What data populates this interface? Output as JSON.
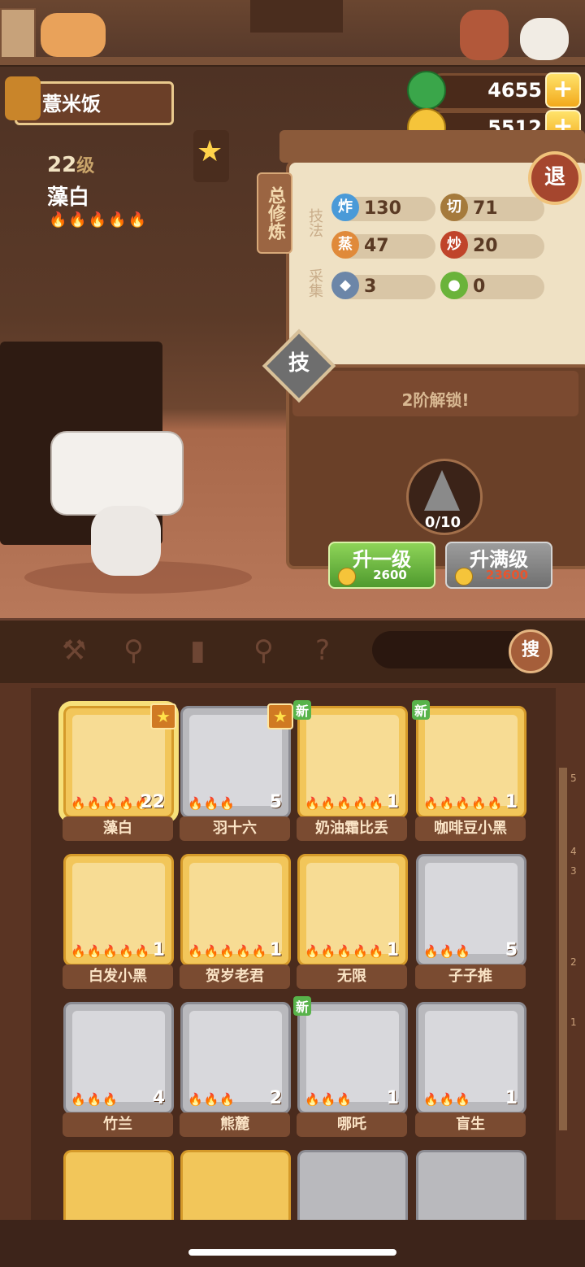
{
  "player": {
    "name": "薏米饭"
  },
  "character": {
    "level": "22",
    "level_suffix": "级",
    "name": "藻白",
    "flames": "🔥🔥🔥🔥🔥"
  },
  "currency": {
    "jade": "4655",
    "coins": "5512"
  },
  "skills": {
    "side_label": "总修炼",
    "category_technique": "技法",
    "category_gather": "采集",
    "stats": [
      {
        "icon": "炸",
        "value": "130",
        "color": "#4a9ad8"
      },
      {
        "icon": "切",
        "value": "71",
        "color": "#a57a3c"
      },
      {
        "icon": "蒸",
        "value": "47",
        "color": "#e08a3a"
      },
      {
        "icon": "炒",
        "value": "20",
        "color": "#c0442a"
      },
      {
        "icon": "fish-icon",
        "value": "3",
        "color": "#6c86a8"
      },
      {
        "icon": "cabbage-icon",
        "value": "0",
        "color": "#6ab33a"
      }
    ],
    "exit_label": "退",
    "skill_tab_label": "技",
    "unlock_text": "2阶解锁!",
    "fragment_count": "0/10"
  },
  "upgrade": {
    "one_label": "升一级",
    "one_cost": "2600",
    "max_label": "升满级",
    "max_cost": "23600"
  },
  "filters": {
    "icons": [
      "spatula-icon",
      "meat-icon",
      "jar-icon",
      "location-pin-icon",
      "map-question-icon"
    ],
    "search_label": "搜"
  },
  "cards": [
    {
      "name": "藻白",
      "level": "22",
      "flames": "🔥🔥🔥🔥🔥",
      "tier": "gold",
      "star": true,
      "new": false,
      "selected": true
    },
    {
      "name": "羽十六",
      "level": "5",
      "flames": "🔥🔥🔥",
      "tier": "silver",
      "star": true,
      "new": false
    },
    {
      "name": "奶油霜比丢",
      "level": "1",
      "flames": "🔥🔥🔥🔥🔥",
      "tier": "gold",
      "star": false,
      "new": true
    },
    {
      "name": "咖啡豆小黑",
      "level": "1",
      "flames": "🔥🔥🔥🔥🔥",
      "tier": "gold",
      "star": false,
      "new": true
    },
    {
      "name": "白发小黑",
      "level": "1",
      "flames": "🔥🔥🔥🔥🔥",
      "tier": "gold",
      "star": false,
      "new": false
    },
    {
      "name": "贺岁老君",
      "level": "1",
      "flames": "🔥🔥🔥🔥🔥",
      "tier": "gold",
      "star": false,
      "new": false
    },
    {
      "name": "无限",
      "level": "1",
      "flames": "🔥🔥🔥🔥🔥",
      "tier": "gold",
      "star": false,
      "new": false
    },
    {
      "name": "子子推",
      "level": "5",
      "flames": "🔥🔥🔥",
      "tier": "silver",
      "star": false,
      "new": false
    },
    {
      "name": "竹兰",
      "level": "4",
      "flames": "🔥🔥🔥",
      "tier": "silver",
      "star": false,
      "new": false
    },
    {
      "name": "熊麓",
      "level": "2",
      "flames": "🔥🔥🔥",
      "tier": "silver",
      "star": false,
      "new": false
    },
    {
      "name": "哪吒",
      "level": "1",
      "flames": "🔥🔥🔥",
      "tier": "silver",
      "star": false,
      "new": true
    },
    {
      "name": "盲生",
      "level": "1",
      "flames": "🔥🔥🔥",
      "tier": "silver",
      "star": false,
      "new": false
    }
  ],
  "labels": {
    "new": "新",
    "star": "★"
  },
  "ruler_ticks": [
    "5",
    "4",
    "3",
    "2",
    "1"
  ]
}
